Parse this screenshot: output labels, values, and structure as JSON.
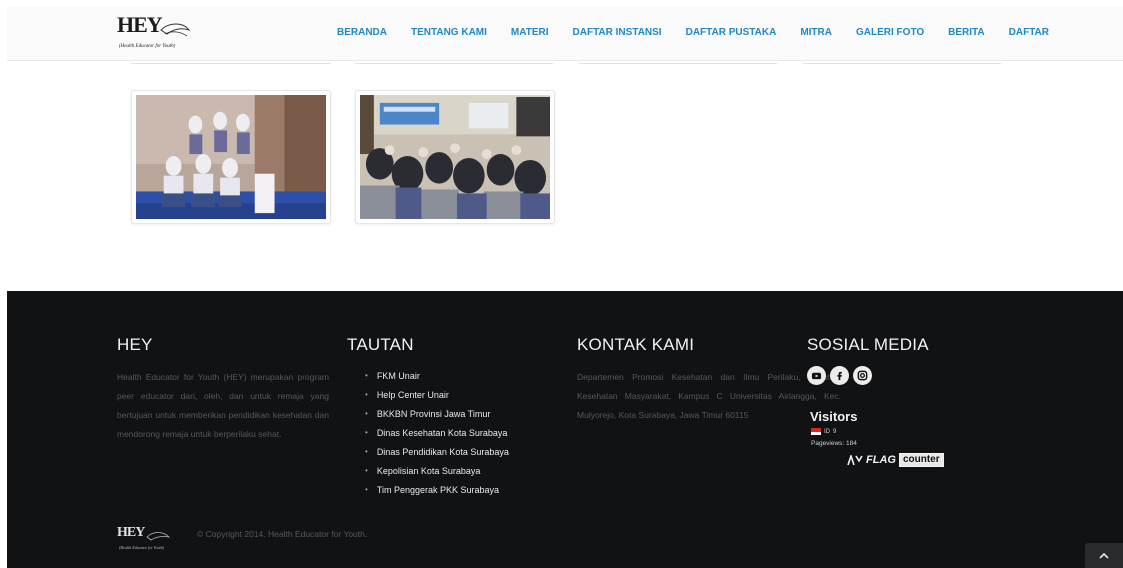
{
  "header": {
    "logo_text": "HEY",
    "logo_tagline": "(Health Educator for Youth)",
    "nav": [
      {
        "label": "BERANDA"
      },
      {
        "label": "TENTANG KAMI"
      },
      {
        "label": "MATERI"
      },
      {
        "label": "DAFTAR INSTANSI"
      },
      {
        "label": "DAFTAR PUSTAKA"
      },
      {
        "label": "MITRA"
      },
      {
        "label": "GALERI FOTO"
      },
      {
        "label": "BERITA"
      },
      {
        "label": "DAFTAR"
      }
    ],
    "accent_color": "#1f87c8"
  },
  "gallery": {
    "photos": [
      {
        "name": "photo-students-group"
      },
      {
        "name": "photo-seminar-audience"
      }
    ]
  },
  "footer": {
    "hey": {
      "title": "HEY",
      "text": "Health Educator for Youth (HEY) merupakan program peer educator dari, oleh, dan untuk remaja yang bertujuan untuk memberikan pendidikan kesehatan dan mendorong remaja untuk berperilaku sehat."
    },
    "tautan": {
      "title": "TAUTAN",
      "links": [
        "FKM Unair",
        "Help Center Unair",
        "BKKBN Provinsi Jawa Timur",
        "Dinas Kesehatan Kota Surabaya",
        "Dinas Pendidikan Kota Surabaya",
        "Kepolisian Kota Surabaya",
        "Tim Penggerak PKK Surabaya"
      ]
    },
    "kontak": {
      "title": "KONTAK KAMI",
      "text": "Departemen Promosi Kesehatan dan Ilmu Perilaku, Fakultas Kesehatan Masyarakat, Kampus C Universitas Airlangga, Kec. Mulyorejo, Kota Surabaya, Jawa Timur 60115"
    },
    "sosial": {
      "title": "SOSIAL MEDIA",
      "icons": [
        "youtube-icon",
        "facebook-icon",
        "instagram-icon"
      ]
    },
    "visitors": {
      "title": "Visitors",
      "country": "ID",
      "count": "9",
      "pageviews": "Pageviews: 184",
      "badge_flag": "FLAG",
      "badge_counter": "counter"
    },
    "logo_text": "HEY",
    "logo_tagline": "(Health Educator for Youth)",
    "copyright": "© Copyright 2014. Health Educator for Youth.",
    "background": "#111214"
  }
}
